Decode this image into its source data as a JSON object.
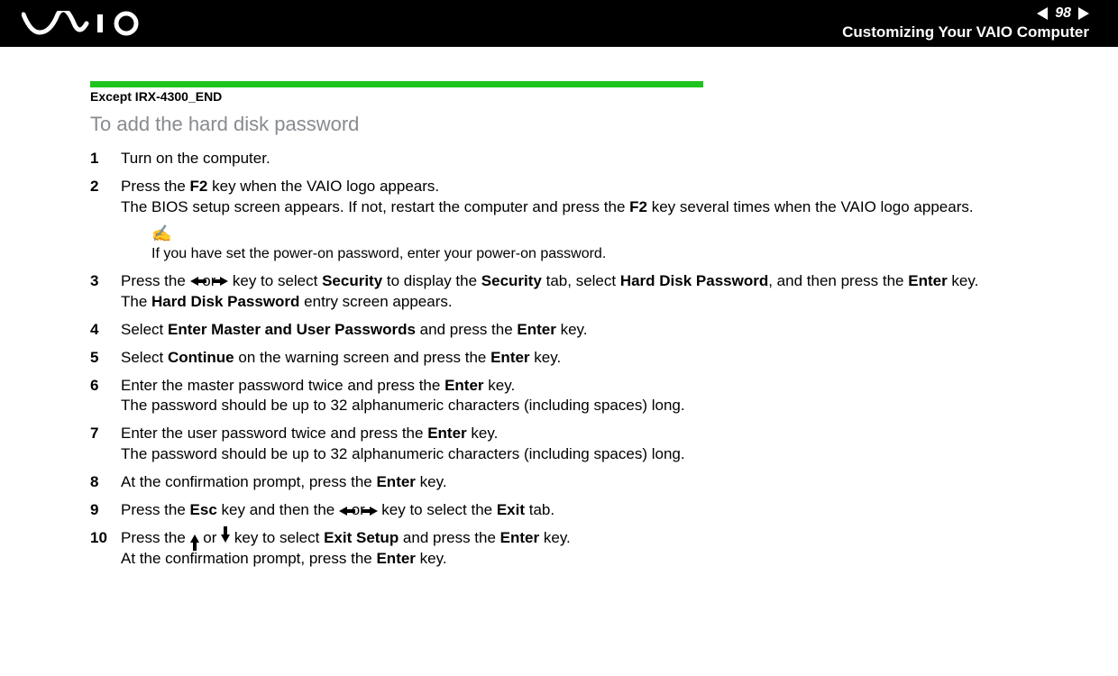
{
  "header": {
    "page_number": "98",
    "section_title": "Customizing Your VAIO Computer"
  },
  "content": {
    "except_label": "Except IRX-4300_END",
    "heading": "To add the hard disk password",
    "steps": {
      "s1": "Turn on the computer.",
      "s2_a": "Press the ",
      "s2_b": " key when the VAIO logo appears.",
      "s2_c": "The BIOS setup screen appears. If not, restart the computer and press the ",
      "s2_d": " key several times when the VAIO logo appears.",
      "key_f2": "F2",
      "note_text": "If you have set the power-on password, enter your power-on password.",
      "s3_a": "Press the ",
      "s3_b": " or ",
      "s3_c": " key to select ",
      "s3_d": " to display the ",
      "s3_e": " tab, select ",
      "s3_f": ", and then press the ",
      "s3_g": " key.",
      "s3_h": "The ",
      "s3_i": " entry screen appears.",
      "security": "Security",
      "hard_disk_password": "Hard Disk Password",
      "enter": "Enter",
      "s4_a": "Select ",
      "s4_b": " and press the ",
      "s4_c": " key.",
      "enter_master_user": "Enter Master and User Passwords",
      "s5_a": "Select ",
      "s5_b": " on the warning screen and press the ",
      "s5_c": " key.",
      "continue": "Continue",
      "s6_a": "Enter the master password twice and press the ",
      "s6_b": " key.",
      "s6_c": "The password should be up to 32 alphanumeric characters (including spaces) long.",
      "s7_a": "Enter the user password twice and press the ",
      "s7_b": " key.",
      "s7_c": "The password should be up to 32 alphanumeric characters (including spaces) long.",
      "s8_a": "At the confirmation prompt, press the ",
      "s8_b": " key.",
      "s9_a": "Press the ",
      "s9_b": " key and then the ",
      "s9_c": " or ",
      "s9_d": " key to select the ",
      "s9_e": " tab.",
      "esc": "Esc",
      "exit": "Exit",
      "s10_a": "Press the ",
      "s10_b": " or ",
      "s10_c": " key to select ",
      "s10_d": " and press the ",
      "s10_e": " key.",
      "s10_f": "At the confirmation prompt, press the ",
      "s10_g": " key.",
      "exit_setup": "Exit Setup"
    }
  }
}
